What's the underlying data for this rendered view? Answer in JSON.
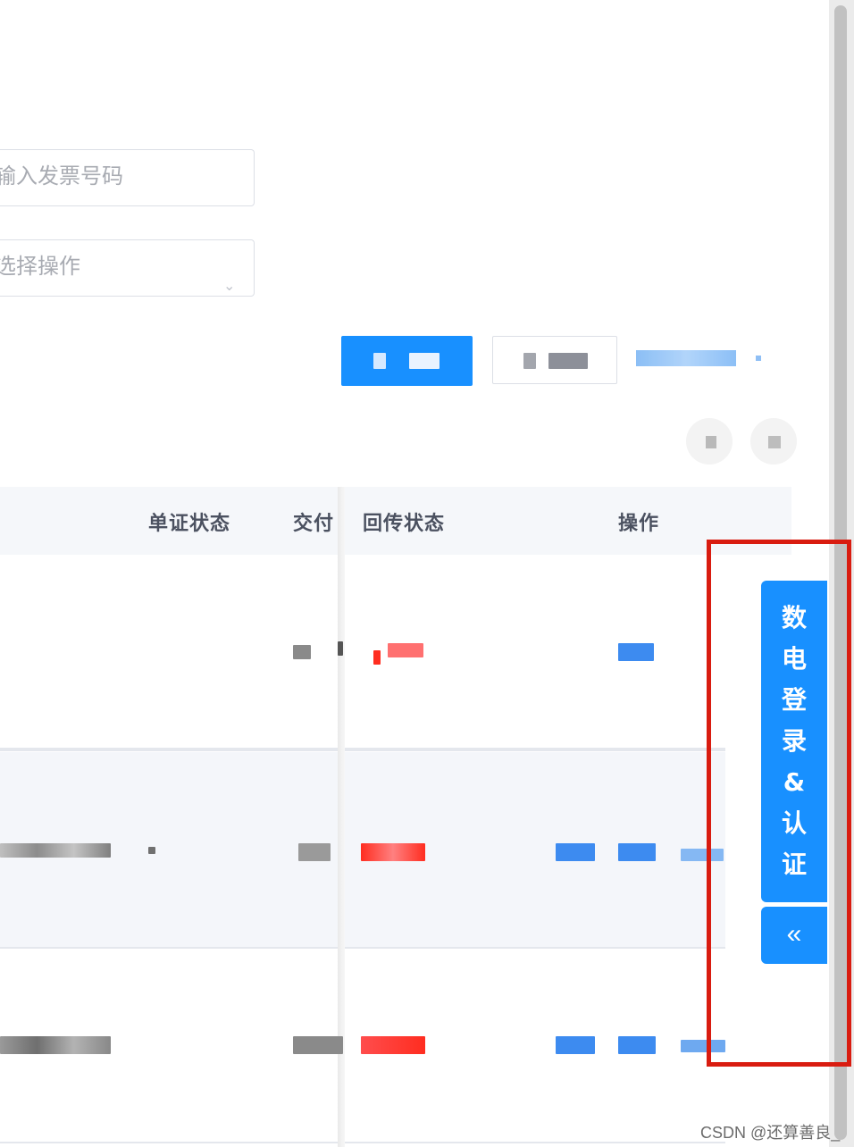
{
  "filters": {
    "invoice_input_placeholder": "输入发票号码",
    "operation_select_placeholder": "选择操作"
  },
  "toolbar": {
    "query_button": "查询",
    "reset_button": "重置",
    "expand_link": "展开"
  },
  "table": {
    "columns": [
      "单证状态",
      "交付",
      "回传状态",
      "操作"
    ]
  },
  "float_panel": {
    "chars": [
      "数",
      "电",
      "登",
      "录",
      "&",
      "认",
      "证"
    ],
    "collapse_icon": "«"
  },
  "watermark": "CSDN @还算善良_",
  "colors": {
    "primary": "#1890ff",
    "danger": "#f5222d",
    "highlight_box": "#d91c10"
  }
}
